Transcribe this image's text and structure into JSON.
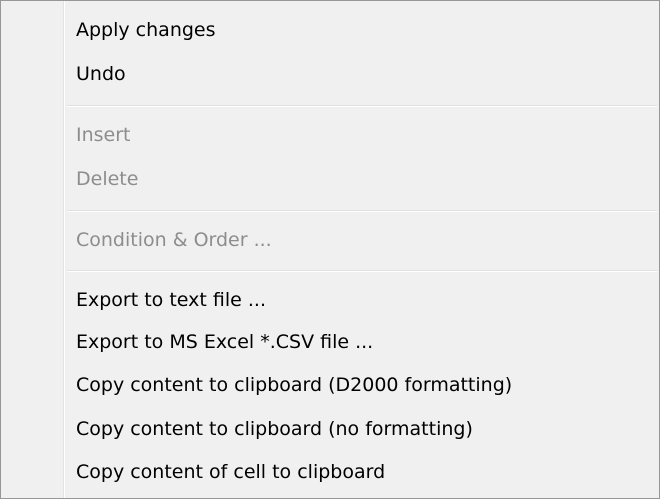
{
  "context_menu": {
    "items": [
      {
        "label": "Apply changes",
        "enabled": true
      },
      {
        "label": "Undo",
        "enabled": true
      },
      {
        "label": "Insert",
        "enabled": false
      },
      {
        "label": "Delete",
        "enabled": false
      },
      {
        "label": "Condition & Order ...",
        "enabled": false
      },
      {
        "label": "Export to text file ...",
        "enabled": true
      },
      {
        "label": "Export to MS Excel *.CSV file ...",
        "enabled": true
      },
      {
        "label": "Copy content to clipboard (D2000 formatting)",
        "enabled": true
      },
      {
        "label": "Copy content to clipboard (no formatting)",
        "enabled": true
      },
      {
        "label": "Copy content of cell to clipboard",
        "enabled": true
      }
    ]
  }
}
